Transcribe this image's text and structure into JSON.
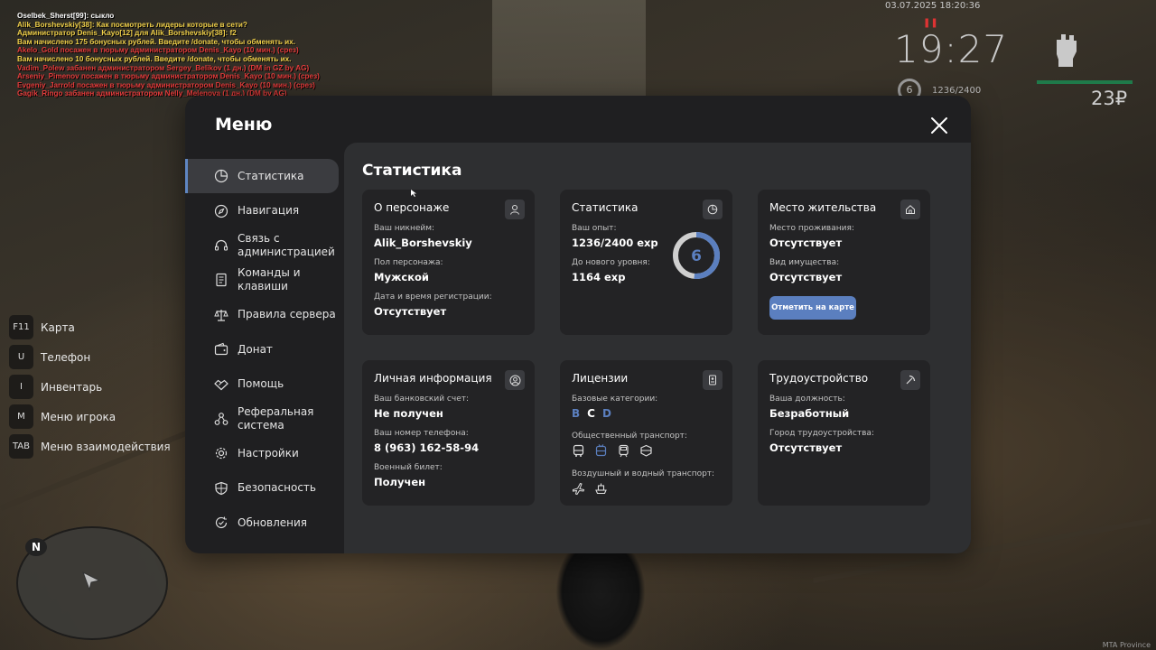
{
  "chat": [
    {
      "text": "Oselbek_Sherst[99]: сыкло",
      "color": "#ffffff"
    },
    {
      "text": "Alik_Borshevskiy[38]: Как посмотреть лидеры которые в сети?",
      "color": "#f0d04a",
      "prefix": "Alik_Borshevskiy[38]:",
      "prefix_color": "#7fe07a"
    },
    {
      "text": "Администратор Denis_Kayo[12] для Alik_Borshevskiy[38]: f2",
      "color": "#f0d04a"
    },
    {
      "text": "Вам начислено 175 бонусных рублей. Введите /donate, чтобы обменять их.",
      "color": "#f0d04a"
    },
    {
      "text": "Akelo_Gold посажен в тюрьму администратором Denis_Kayo (10 мин.) (срез)",
      "color": "#e23b3b"
    },
    {
      "text": "Вам начислено 10 бонусных рублей. Введите /donate, чтобы обменять их.",
      "color": "#f0d04a"
    },
    {
      "text": "Vadim_Polew забанен администратором Sergey_Belikov (1 дн.) (DM in GZ by AG)",
      "color": "#e23b3b"
    },
    {
      "text": "Arseniy_Pimenov посажен в тюрьму администратором Denis_Kayo (10 мин.) (срез)",
      "color": "#e23b3b"
    },
    {
      "text": "Evgeniy_Jarrold посажен в тюрьму администратором Denis_Kayo (10 мин.) (срез)",
      "color": "#e23b3b"
    },
    {
      "text": "Gagik_Ringo забанен администратором Nelly_Melenova (1 дн.) (DM by AG)",
      "color": "#e23b3b"
    }
  ],
  "hud": {
    "date": "03.07.2025 18:20:36",
    "time": "19:27",
    "level": "6",
    "exp": "1236/2400",
    "money": "23₽"
  },
  "keybinds": [
    {
      "key": "F11",
      "label": "Карта"
    },
    {
      "key": "U",
      "label": "Телефон"
    },
    {
      "key": "I",
      "label": "Инвентарь"
    },
    {
      "key": "M",
      "label": "Меню игрока"
    },
    {
      "key": "TAB",
      "label": "Меню взаимодействия"
    }
  ],
  "minimap": {
    "north": "N"
  },
  "watermark": "MTA Province",
  "menu": {
    "title": "Меню",
    "nav": [
      {
        "label": "Статистика",
        "icon": "pie-chart-icon",
        "active": true
      },
      {
        "label": "Навигация",
        "icon": "compass-icon"
      },
      {
        "label": "Связь с\nадминистрацией",
        "icon": "headset-icon"
      },
      {
        "label": "Команды и\nклавиши",
        "icon": "document-icon"
      },
      {
        "label": "Правила сервера",
        "icon": "scales-icon"
      },
      {
        "label": "Донат",
        "icon": "wallet-icon"
      },
      {
        "label": "Помощь",
        "icon": "handshake-icon"
      },
      {
        "label": "Реферальная\nсистема",
        "icon": "network-icon"
      },
      {
        "label": "Настройки",
        "icon": "gear-icon"
      },
      {
        "label": "Безопасность",
        "icon": "shield-icon"
      },
      {
        "label": "Обновления",
        "icon": "refresh-icon"
      }
    ],
    "content_title": "Статистика",
    "cards": {
      "character": {
        "title": "О персонаже",
        "nickname_label": "Ваш никнейм:",
        "nickname": "Alik_Borshevskiy",
        "gender_label": "Пол персонажа:",
        "gender": "Мужской",
        "reg_label": "Дата и время регистрации:",
        "reg": "Отсутствует"
      },
      "stats": {
        "title": "Статистика",
        "exp_label": "Ваш опыт:",
        "exp": "1236/2400 exp",
        "next_label": "До нового уровня:",
        "next": "1164 exp",
        "level": "6",
        "progress": 0.515
      },
      "residence": {
        "title": "Место жительства",
        "place_label": "Место проживания:",
        "place": "Отсутствует",
        "property_label": "Вид имущества:",
        "property": "Отсутствует",
        "button": "Отметить на карте"
      },
      "personal": {
        "title": "Личная информация",
        "bank_label": "Ваш банковский счет:",
        "bank": "Не получен",
        "phone_label": "Ваш номер телефона:",
        "phone": "8 (963) 162-58-94",
        "military_label": "Военный билет:",
        "military": "Получен"
      },
      "licenses": {
        "title": "Лицензии",
        "base_label": "Базовые категории:",
        "categories": [
          {
            "letter": "B",
            "color": "#5b7fbf"
          },
          {
            "letter": "C",
            "color": "#ffffff"
          },
          {
            "letter": "D",
            "color": "#5b7fbf"
          }
        ],
        "public_label": "Общественный транспорт:",
        "air_label": "Воздушный и водный транспорт:"
      },
      "employment": {
        "title": "Трудоустройство",
        "position_label": "Ваша должность:",
        "position": "Безработный",
        "city_label": "Город трудоустройства:",
        "city": "Отсутствует"
      }
    }
  }
}
